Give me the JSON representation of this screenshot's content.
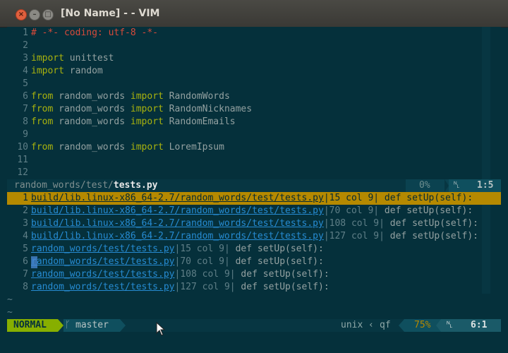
{
  "window": {
    "title": "[No Name] - - VIM"
  },
  "code_lines": [
    {
      "n": "1",
      "parts": [
        {
          "c": "str",
          "t": "# -*- coding: utf-8 -*-"
        }
      ]
    },
    {
      "n": "2",
      "parts": []
    },
    {
      "n": "3",
      "parts": [
        {
          "c": "kw",
          "t": "import"
        },
        {
          "c": "txt",
          "t": " unittest"
        }
      ]
    },
    {
      "n": "4",
      "parts": [
        {
          "c": "kw",
          "t": "import"
        },
        {
          "c": "txt",
          "t": " random"
        }
      ]
    },
    {
      "n": "5",
      "parts": []
    },
    {
      "n": "6",
      "parts": [
        {
          "c": "kw",
          "t": "from"
        },
        {
          "c": "txt",
          "t": " random_words "
        },
        {
          "c": "kw",
          "t": "import"
        },
        {
          "c": "txt",
          "t": " RandomWords"
        }
      ]
    },
    {
      "n": "7",
      "parts": [
        {
          "c": "kw",
          "t": "from"
        },
        {
          "c": "txt",
          "t": " random_words "
        },
        {
          "c": "kw",
          "t": "import"
        },
        {
          "c": "txt",
          "t": " RandomNicknames"
        }
      ]
    },
    {
      "n": "8",
      "parts": [
        {
          "c": "kw",
          "t": "from"
        },
        {
          "c": "txt",
          "t": " random_words "
        },
        {
          "c": "kw",
          "t": "import"
        },
        {
          "c": "txt",
          "t": " RandomEmails"
        }
      ]
    },
    {
      "n": "9",
      "parts": []
    },
    {
      "n": "10",
      "parts": [
        {
          "c": "kw",
          "t": "from"
        },
        {
          "c": "txt",
          "t": " random_words "
        },
        {
          "c": "kw",
          "t": "import"
        },
        {
          "c": "txt",
          "t": " LoremIpsum"
        }
      ]
    },
    {
      "n": "11",
      "parts": []
    },
    {
      "n": "12",
      "parts": []
    }
  ],
  "status_top": {
    "path_dir": "random_words/test/",
    "path_file": "tests.py",
    "percent": "0%",
    "ln_icon": "line-number-icon",
    "position": "1:5"
  },
  "quickfix": [
    {
      "n": "1",
      "file": "build/lib.linux-x86_64-2.7/random_words/test/tests.py",
      "loc": "15 col 9",
      "text": " def setUp(self):"
    },
    {
      "n": "2",
      "file": "build/lib.linux-x86_64-2.7/random_words/test/tests.py",
      "loc": "70 col 9",
      "text": " def setUp(self):"
    },
    {
      "n": "3",
      "file": "build/lib.linux-x86_64-2.7/random_words/test/tests.py",
      "loc": "108 col 9",
      "text": " def setUp(self):"
    },
    {
      "n": "4",
      "file": "build/lib.linux-x86_64-2.7/random_words/test/tests.py",
      "loc": "127 col 9",
      "text": " def setUp(self):"
    },
    {
      "n": "5",
      "file": "random_words/test/tests.py",
      "loc": "15 col 9",
      "text": " def setUp(self):"
    },
    {
      "n": "6",
      "file": "random_words/test/tests.py",
      "loc": "70 col 9",
      "text": " def setUp(self):"
    },
    {
      "n": "7",
      "file": "random_words/test/tests.py",
      "loc": "108 col 9",
      "text": " def setUp(self):"
    },
    {
      "n": "8",
      "file": "random_words/test/tests.py",
      "loc": "127 col 9",
      "text": " def setUp(self):"
    }
  ],
  "status_bottom": {
    "mode": "NORMAL",
    "branch_icon": "git-branch-icon",
    "branch": "master",
    "fileformat": "unix",
    "filetype": "qf",
    "percent": "75%",
    "position": "6:1"
  },
  "colors": {
    "background": "#05303b",
    "mode_bg": "#87af00",
    "qf_selected": "#b58900"
  }
}
